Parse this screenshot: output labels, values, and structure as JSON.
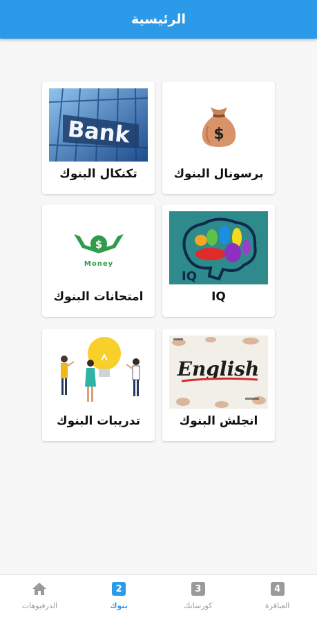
{
  "appbar": {
    "title": "الرئيسية"
  },
  "cards": [
    {
      "label": "برسونال البنوك",
      "icon": "money-bag-icon"
    },
    {
      "label": "تكنكال البنوك",
      "image_text": "Bank"
    },
    {
      "label": "IQ",
      "image_text": "IQ"
    },
    {
      "label": "امتحانات البنوك",
      "image_text": "Money"
    },
    {
      "label": "انجلش البنوك",
      "image_text": "English"
    },
    {
      "label": "تدريبات البنوك",
      "icon": "training-people-icon"
    }
  ],
  "bottom_nav": {
    "items": [
      {
        "badge": "4",
        "label": "العباقرة",
        "active": false
      },
      {
        "badge": "3",
        "label": "كورساتك",
        "active": false
      },
      {
        "badge": "2",
        "label": "بنوك",
        "active": true
      },
      {
        "badge": "",
        "label": "الدرفيوهات",
        "icon": "home-icon",
        "active": false
      }
    ]
  },
  "colors": {
    "accent": "#2b9ae8",
    "inactive": "#9a9a9a"
  }
}
